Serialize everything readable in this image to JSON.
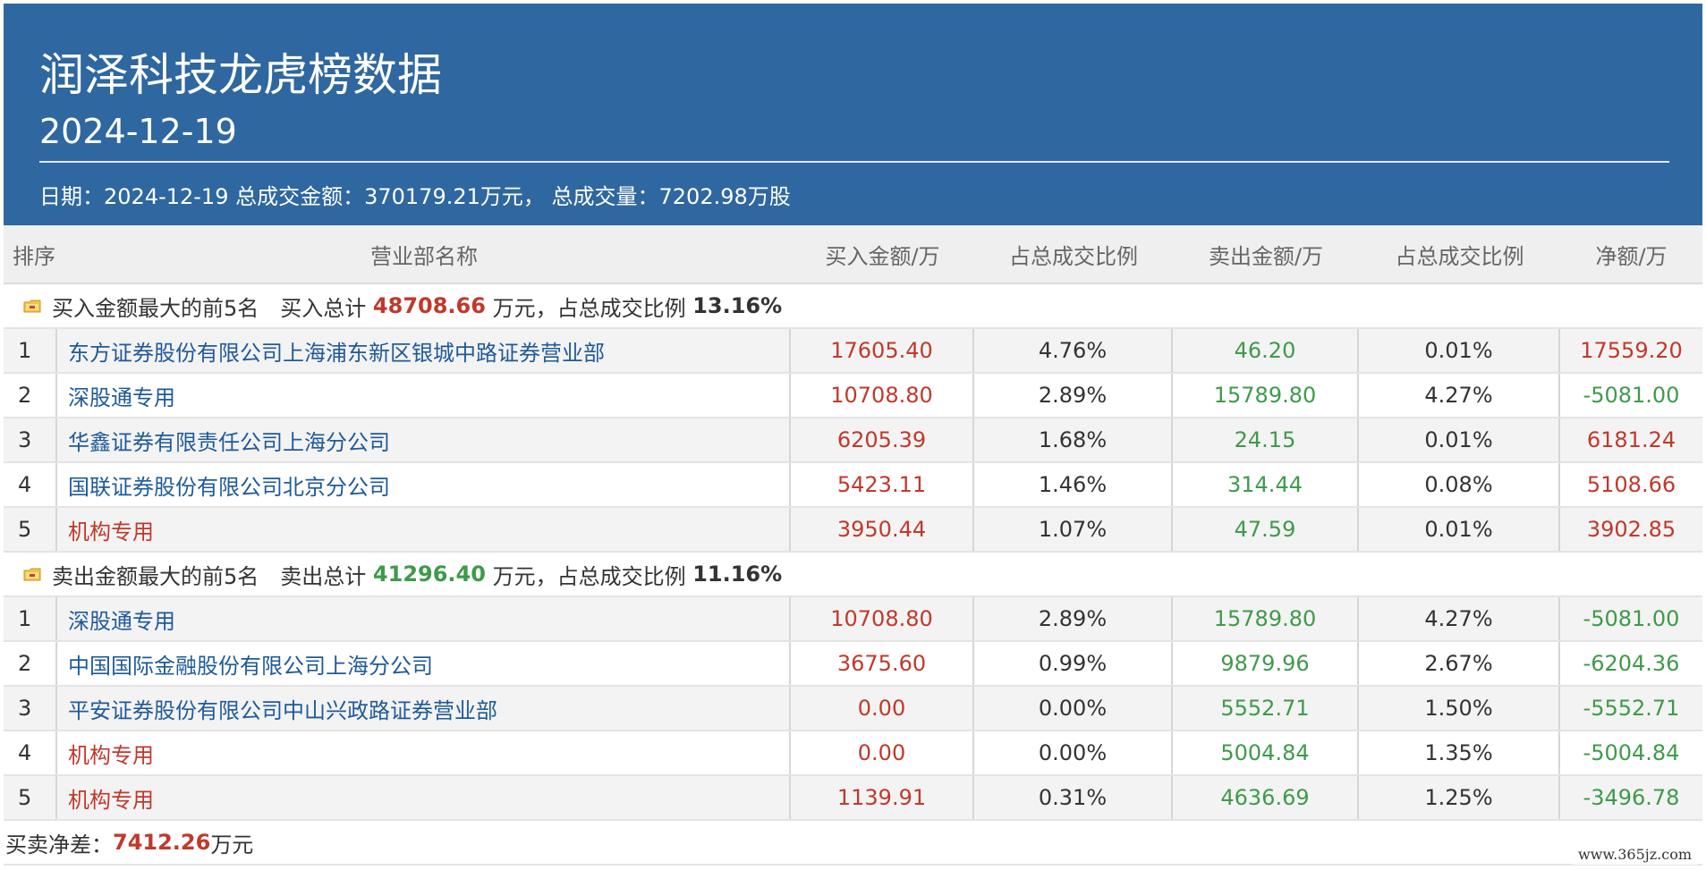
{
  "header": {
    "title": "润泽科技龙虎榜数据",
    "date": "2024-12-19",
    "summary": "日期：2024-12-19 总成交金额：370179.21万元， 总成交量：7202.98万股",
    "bg_color": "#2f67a0"
  },
  "table": {
    "columns": [
      "排序",
      "营业部名称",
      "买入金额/万",
      "占总成交比例",
      "卖出金额/万",
      "占总成交比例",
      "净额/万"
    ],
    "buy_section": {
      "icon": "folder-icon",
      "label": "买入金额最大的前5名",
      "total_prefix": "买入总计",
      "total_value": "48708.66",
      "total_unit_ratio_prefix": "万元，占总成交比例",
      "ratio": "13.16%",
      "rows": [
        {
          "rank": "1",
          "name": "东方证券股份有限公司上海浦东新区银城中路证券营业部",
          "name_color": "blue",
          "buy": "17605.40",
          "buy_pct": "4.76%",
          "sell": "46.20",
          "sell_pct": "0.01%",
          "net": "17559.20",
          "net_color": "red"
        },
        {
          "rank": "2",
          "name": "深股通专用",
          "name_color": "blue",
          "buy": "10708.80",
          "buy_pct": "2.89%",
          "sell": "15789.80",
          "sell_pct": "4.27%",
          "net": "-5081.00",
          "net_color": "green"
        },
        {
          "rank": "3",
          "name": "华鑫证券有限责任公司上海分公司",
          "name_color": "blue",
          "buy": "6205.39",
          "buy_pct": "1.68%",
          "sell": "24.15",
          "sell_pct": "0.01%",
          "net": "6181.24",
          "net_color": "red"
        },
        {
          "rank": "4",
          "name": "国联证券股份有限公司北京分公司",
          "name_color": "blue",
          "buy": "5423.11",
          "buy_pct": "1.46%",
          "sell": "314.44",
          "sell_pct": "0.08%",
          "net": "5108.66",
          "net_color": "red"
        },
        {
          "rank": "5",
          "name": "机构专用",
          "name_color": "red",
          "buy": "3950.44",
          "buy_pct": "1.07%",
          "sell": "47.59",
          "sell_pct": "0.01%",
          "net": "3902.85",
          "net_color": "red"
        }
      ]
    },
    "sell_section": {
      "icon": "folder-icon",
      "label": "卖出金额最大的前5名",
      "total_prefix": "卖出总计",
      "total_value": "41296.40",
      "total_unit_ratio_prefix": "万元，占总成交比例",
      "ratio": "11.16%",
      "rows": [
        {
          "rank": "1",
          "name": "深股通专用",
          "name_color": "blue",
          "buy": "10708.80",
          "buy_pct": "2.89%",
          "sell": "15789.80",
          "sell_pct": "4.27%",
          "net": "-5081.00",
          "net_color": "green"
        },
        {
          "rank": "2",
          "name": "中国国际金融股份有限公司上海分公司",
          "name_color": "blue",
          "buy": "3675.60",
          "buy_pct": "0.99%",
          "sell": "9879.96",
          "sell_pct": "2.67%",
          "net": "-6204.36",
          "net_color": "green"
        },
        {
          "rank": "3",
          "name": "平安证券股份有限公司中山兴政路证券营业部",
          "name_color": "blue",
          "buy": "0.00",
          "buy_pct": "0.00%",
          "sell": "5552.71",
          "sell_pct": "1.50%",
          "net": "-5552.71",
          "net_color": "green"
        },
        {
          "rank": "4",
          "name": "机构专用",
          "name_color": "red",
          "buy": "0.00",
          "buy_pct": "0.00%",
          "sell": "5004.84",
          "sell_pct": "1.35%",
          "net": "-5004.84",
          "net_color": "green"
        },
        {
          "rank": "5",
          "name": "机构专用",
          "name_color": "red",
          "buy": "1139.91",
          "buy_pct": "0.31%",
          "sell": "4636.69",
          "sell_pct": "1.25%",
          "net": "-3496.78",
          "net_color": "green"
        }
      ]
    },
    "footer": {
      "label": "买卖净差：",
      "value": "7412.26",
      "unit": "万元"
    }
  },
  "watermark": "www.365jz.com",
  "colors": {
    "buy_red": "#c0392b",
    "sell_green": "#3f9a4a",
    "link_blue": "#1f5a99"
  }
}
